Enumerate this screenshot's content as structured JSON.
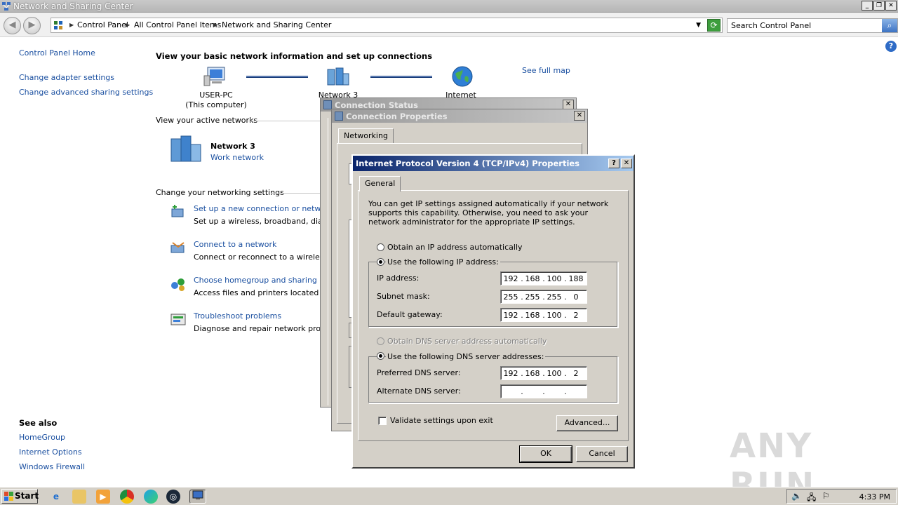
{
  "window": {
    "title": "Network and Sharing Center",
    "controls": {
      "minimize": "_",
      "restore": "❐",
      "close": "✕"
    }
  },
  "navbar": {
    "breadcrumbs": [
      "Control Panel",
      "All Control Panel Items",
      "Network and Sharing Center"
    ],
    "search_placeholder": "Search Control Panel"
  },
  "left_pane": {
    "home": "Control Panel Home",
    "links": [
      "Change adapter settings",
      "Change advanced sharing settings"
    ],
    "see_also_title": "See also",
    "see_also": [
      "HomeGroup",
      "Internet Options",
      "Windows Firewall"
    ]
  },
  "main": {
    "heading": "View your basic network information and set up connections",
    "map_nodes": [
      {
        "label": "USER-PC",
        "sub": "(This computer)"
      },
      {
        "label": "Network  3",
        "sub": ""
      },
      {
        "label": "Internet",
        "sub": ""
      }
    ],
    "see_full_map": "See full map",
    "active_networks_label": "View your active networks",
    "active_network": {
      "name": "Network  3",
      "type": "Work network"
    },
    "change_settings_label": "Change your networking settings",
    "tasks": [
      {
        "title": "Set up a new connection or network",
        "desc": "Set up a wireless, broadband, dial-up"
      },
      {
        "title": "Connect to a network",
        "desc": "Connect or reconnect to a wireless, w"
      },
      {
        "title": "Choose homegroup and sharing optio",
        "desc": "Access files and printers located on ot"
      },
      {
        "title": "Troubleshoot problems",
        "desc": "Diagnose and repair network problem"
      }
    ]
  },
  "dialogs": {
    "status_title": "Connection Status",
    "properties_title": "Connection Properties",
    "properties_tab": "Networking"
  },
  "ipv4": {
    "title": "Internet Protocol Version 4 (TCP/IPv4) Properties",
    "help_btn": "?",
    "close_btn": "✕",
    "tab": "General",
    "description": "You can get IP settings assigned automatically if your network supports this capability. Otherwise, you need to ask your network administrator for the appropriate IP settings.",
    "obtain_ip_auto": "Obtain an IP address automatically",
    "use_following_ip": "Use the following IP address:",
    "ip_label": "IP address:",
    "ip_value": [
      "192",
      "168",
      "100",
      "188"
    ],
    "mask_label": "Subnet mask:",
    "mask_value": [
      "255",
      "255",
      "255",
      "0"
    ],
    "gateway_label": "Default gateway:",
    "gateway_value": [
      "192",
      "168",
      "100",
      "2"
    ],
    "obtain_dns_auto": "Obtain DNS server address automatically",
    "use_following_dns": "Use the following DNS server addresses:",
    "preferred_dns_label": "Preferred DNS server:",
    "preferred_dns_value": [
      "192",
      "168",
      "100",
      "2"
    ],
    "alternate_dns_label": "Alternate DNS server:",
    "alternate_dns_value": [
      "",
      "",
      "",
      ""
    ],
    "validate_label": "Validate settings upon exit",
    "advanced_btn": "Advanced...",
    "ok_btn": "OK",
    "cancel_btn": "Cancel"
  },
  "taskbar": {
    "start": "Start",
    "clock": "4:33 PM"
  },
  "watermark": "ANY RUN"
}
